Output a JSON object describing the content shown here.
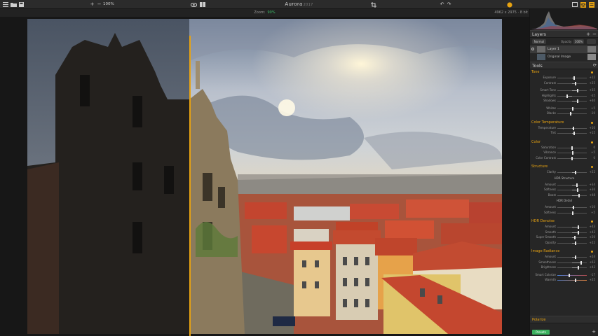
{
  "app": {
    "title": "Aurora",
    "title_suffix": "2017"
  },
  "toolbar": {
    "zoom_level": "100%"
  },
  "subbar": {
    "zoom_label": "Zoom:",
    "zoom_value": "90%",
    "image_size": "4962 x 2975 · 8 bit"
  },
  "colors": {
    "accent": "#e8a311",
    "green": "#3bb25f"
  },
  "layers": {
    "title": "Layers",
    "blend_mode": "Normal",
    "opacity_label": "Opacity",
    "opacity_value": "100%",
    "items": [
      {
        "name": "Layer 1"
      },
      {
        "name": "Original Image"
      }
    ]
  },
  "tools": {
    "title": "Tools"
  },
  "groups": {
    "tone": {
      "title": "Tone",
      "sliders": [
        {
          "label": "Exposure",
          "value": "+12",
          "pos": 0.58
        },
        {
          "label": "Contrast",
          "value": "+25",
          "pos": 0.62
        },
        {
          "label": "Smart Tone",
          "value": "+35",
          "pos": 0.68
        },
        {
          "label": "Highlights",
          "value": "-35",
          "pos": 0.33
        },
        {
          "label": "Shadows",
          "value": "+40",
          "pos": 0.7
        },
        {
          "label": "Whites",
          "value": "+5",
          "pos": 0.53
        },
        {
          "label": "Blacks",
          "value": "-10",
          "pos": 0.45
        }
      ]
    },
    "color_temperature": {
      "title": "Color Temperature",
      "sliders": [
        {
          "label": "Temperature",
          "value": "+10",
          "pos": 0.55
        },
        {
          "label": "Tint",
          "value": "+15",
          "pos": 0.58
        }
      ]
    },
    "color": {
      "title": "Color",
      "sliders": [
        {
          "label": "Saturation",
          "value": "0",
          "pos": 0.5
        },
        {
          "label": "Vibrance",
          "value": "+5",
          "pos": 0.53
        },
        {
          "label": "Color Contrast",
          "value": "0",
          "pos": 0.5
        }
      ]
    },
    "structure": {
      "title": "Structure",
      "sliders": [
        {
          "label": "Clarity",
          "value": "+22",
          "pos": 0.61
        }
      ],
      "hdr_structure": {
        "title": "HDR Structure",
        "sliders": [
          {
            "label": "Amount",
            "value": "+34",
            "pos": 0.67
          },
          {
            "label": "Softness",
            "value": "+36",
            "pos": 0.68
          },
          {
            "label": "Boost",
            "value": "+48",
            "pos": 0.74
          }
        ]
      },
      "hdr_detail": {
        "title": "HDR Detail",
        "sliders": [
          {
            "label": "Amount",
            "value": "+10",
            "pos": 0.55
          },
          {
            "label": "Softness",
            "value": "+5",
            "pos": 0.53
          }
        ]
      }
    },
    "hdr_denoise": {
      "title": "HDR Denoise",
      "sliders": [
        {
          "label": "Amount",
          "value": "+43",
          "pos": 0.71
        },
        {
          "label": "Smooth",
          "value": "+43",
          "pos": 0.71
        },
        {
          "label": "Super Smooth",
          "value": "+20",
          "pos": 0.6
        },
        {
          "label": "Opacity",
          "value": "+22",
          "pos": 0.61
        }
      ]
    },
    "image_radiance": {
      "title": "Image Radiance",
      "sliders": [
        {
          "label": "Amount",
          "value": "+24",
          "pos": 0.62
        },
        {
          "label": "Smoothness",
          "value": "+63",
          "pos": 0.81
        },
        {
          "label": "Brightness",
          "value": "+43",
          "pos": 0.71
        },
        {
          "label": "Smart Colorize",
          "value": "-17",
          "pos": 0.41
        },
        {
          "label": "Warmth",
          "value": "+25",
          "pos": 0.62
        }
      ]
    },
    "polarize": {
      "title": "Polarize"
    }
  },
  "footer": {
    "presets_label": "Presets"
  }
}
